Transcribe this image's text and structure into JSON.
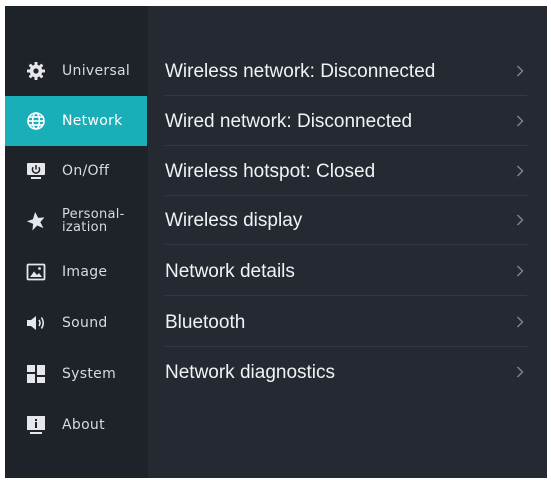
{
  "sidebar": {
    "items": [
      {
        "label": "Universal",
        "icon": "gear-icon"
      },
      {
        "label": "Network",
        "icon": "globe-icon",
        "active": true
      },
      {
        "label": "On/Off",
        "icon": "monitor-power-icon"
      },
      {
        "label": "Personal-\nization",
        "icon": "star-icon"
      },
      {
        "label": "Image",
        "icon": "picture-icon"
      },
      {
        "label": "Sound",
        "icon": "speaker-icon"
      },
      {
        "label": "System",
        "icon": "grid-icon"
      },
      {
        "label": "About",
        "icon": "info-screen-icon"
      }
    ]
  },
  "main": {
    "items": [
      {
        "label": "Wireless network: Disconnected"
      },
      {
        "label": "Wired network: Disconnected"
      },
      {
        "label": "Wireless hotspot: Closed"
      },
      {
        "label": "Wireless display"
      },
      {
        "label": "Network details"
      },
      {
        "label": "Bluetooth"
      },
      {
        "label": "Network diagnostics"
      }
    ]
  },
  "colors": {
    "background": "#252932",
    "sidebar": "#1e2229",
    "accent": "#1aaeb8",
    "text": "#f1f2f4",
    "chevron": "#7b808a"
  }
}
